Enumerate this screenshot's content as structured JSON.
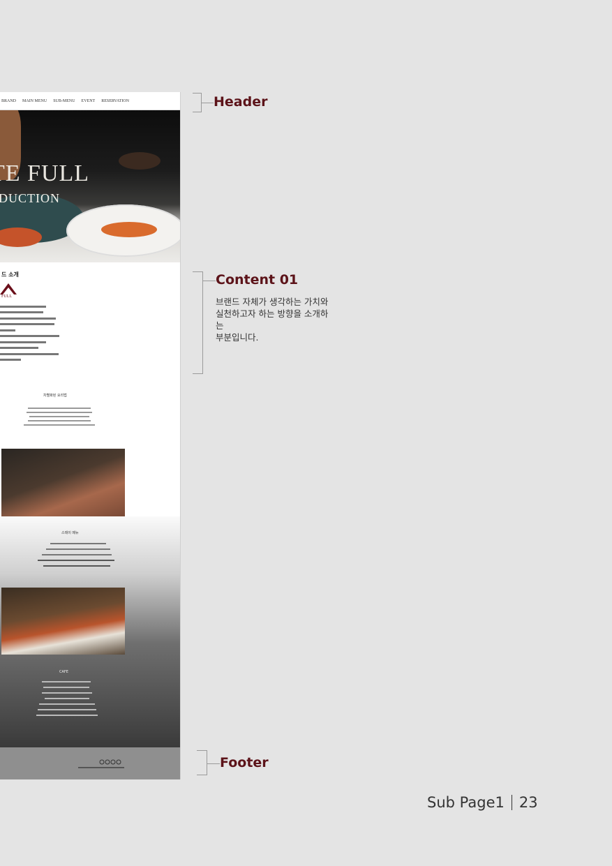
{
  "mockup": {
    "nav": [
      "BRAND",
      "MAIN MENU",
      "SUB-MENU",
      "EVENT",
      "RESERVATION"
    ],
    "hero_title": "TE FULL",
    "hero_subtitle": "DUCTION",
    "content_title": "드 소개",
    "logo_text": "FULL",
    "card1_title": "차별화된 요리법",
    "card2_title": "스테이 메뉴",
    "card3_title": "CAFE"
  },
  "annotations": {
    "header": "Header",
    "content": "Content 01",
    "content_desc": "브랜드 자체가 생각하는 가치와\n실천하고자 하는 방향을 소개하\n는\n부분입니다.",
    "footer": "Footer"
  },
  "page": {
    "title": "Sub Page1",
    "number": "23"
  },
  "colors": {
    "label": "#5c1319",
    "background": "#e4e4e4"
  }
}
